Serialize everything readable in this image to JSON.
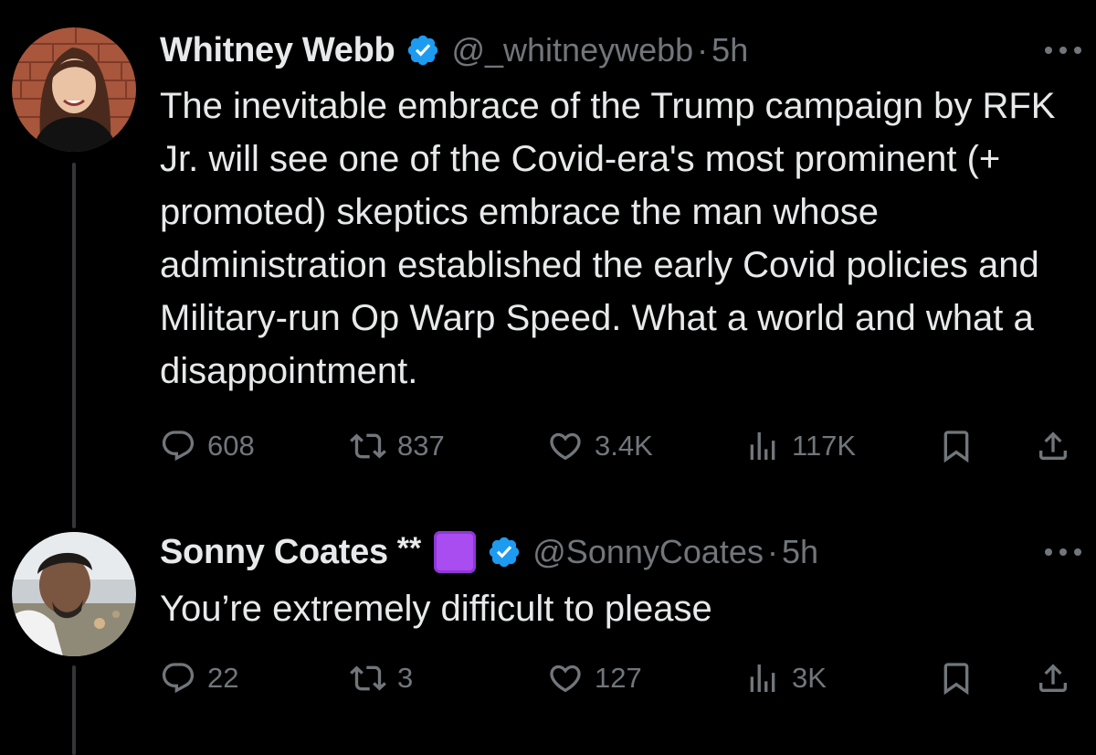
{
  "tweets": [
    {
      "display_name": "Whitney Webb",
      "name_suffix": "",
      "handle": "@_whitneywebb",
      "separator": "·",
      "time": "5h",
      "text": "The inevitable embrace of the Trump campaign by RFK Jr. will see one of the Covid-era's most prominent (+ promoted) skeptics embrace the man whose administration established the early Covid policies and Military-run Op Warp Speed. What a world and what a disappointment.",
      "replies": "608",
      "reposts": "837",
      "likes": "3.4K",
      "views": "117K"
    },
    {
      "display_name": "Sonny Coates",
      "name_suffix": "**",
      "name_emoji": "purple-square",
      "handle": "@SonnyCoates",
      "separator": "·",
      "time": "5h",
      "text": "You’re extremely difficult to please",
      "replies": "22",
      "reposts": "3",
      "likes": "127",
      "views": "3K"
    }
  ],
  "icons": {
    "verified": "verified-badge-icon",
    "more": "more-options-icon",
    "reply": "reply-icon",
    "repost": "repost-icon",
    "like": "like-icon",
    "views": "views-icon",
    "bookmark": "bookmark-icon",
    "share": "share-icon"
  },
  "colors": {
    "background": "#000000",
    "text": "#e7e9ea",
    "secondary": "#71767b",
    "verified": "#1d9bf0",
    "thread_line": "#333639",
    "emoji_purple": "#a94cf0"
  }
}
